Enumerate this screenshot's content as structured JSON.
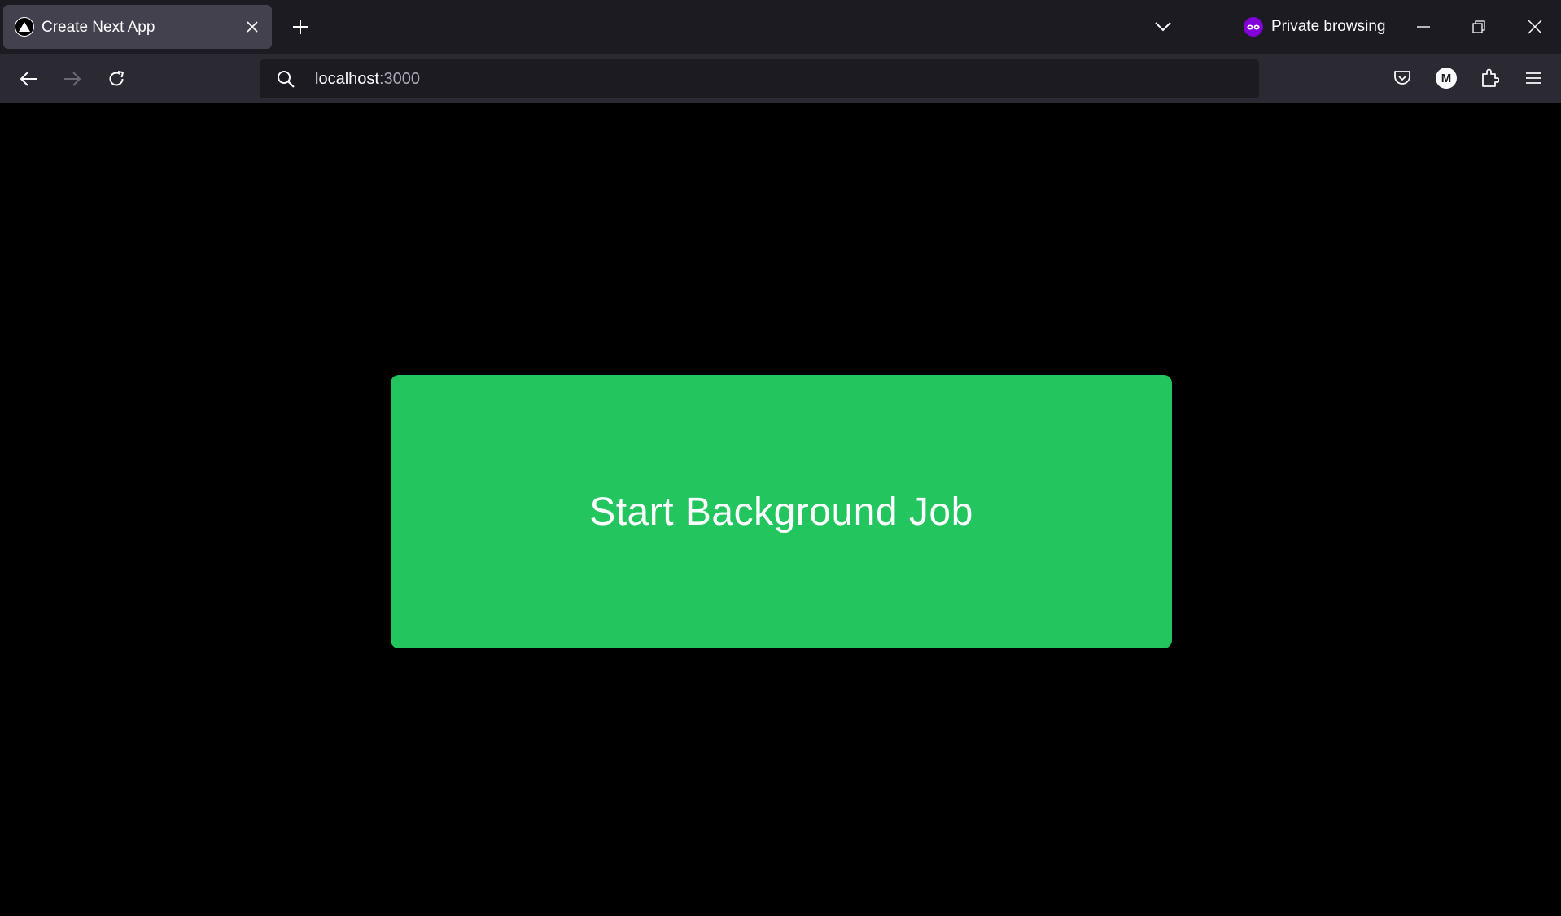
{
  "browser": {
    "tab": {
      "title": "Create Next App",
      "favicon": "nextjs-triangle-icon"
    },
    "private_browsing_label": "Private browsing",
    "url": {
      "host": "localhost",
      "port": ":3000"
    },
    "profile_initial": "M",
    "icons": {
      "new_tab": "plus-icon",
      "list_all_tabs": "chevron-down-icon",
      "private": "private-mask-icon",
      "minimize": "minimize-icon",
      "restore": "restore-icon",
      "close_window": "close-icon",
      "back": "arrow-left-icon",
      "forward": "arrow-right-icon",
      "reload": "reload-icon",
      "search": "search-icon",
      "pocket": "pocket-icon",
      "extensions": "puzzle-icon",
      "menu": "hamburger-icon"
    },
    "colors": {
      "tabstrip": "#1c1b22",
      "active_tab": "#42414d",
      "navbar": "#2b2a33",
      "urlbar": "#1c1b22",
      "text": "#fbfbfe",
      "private_accent": "#8000d7"
    }
  },
  "page": {
    "background": "#000000",
    "start_button": {
      "label": "Start Background Job",
      "color": "#22c55e"
    }
  }
}
